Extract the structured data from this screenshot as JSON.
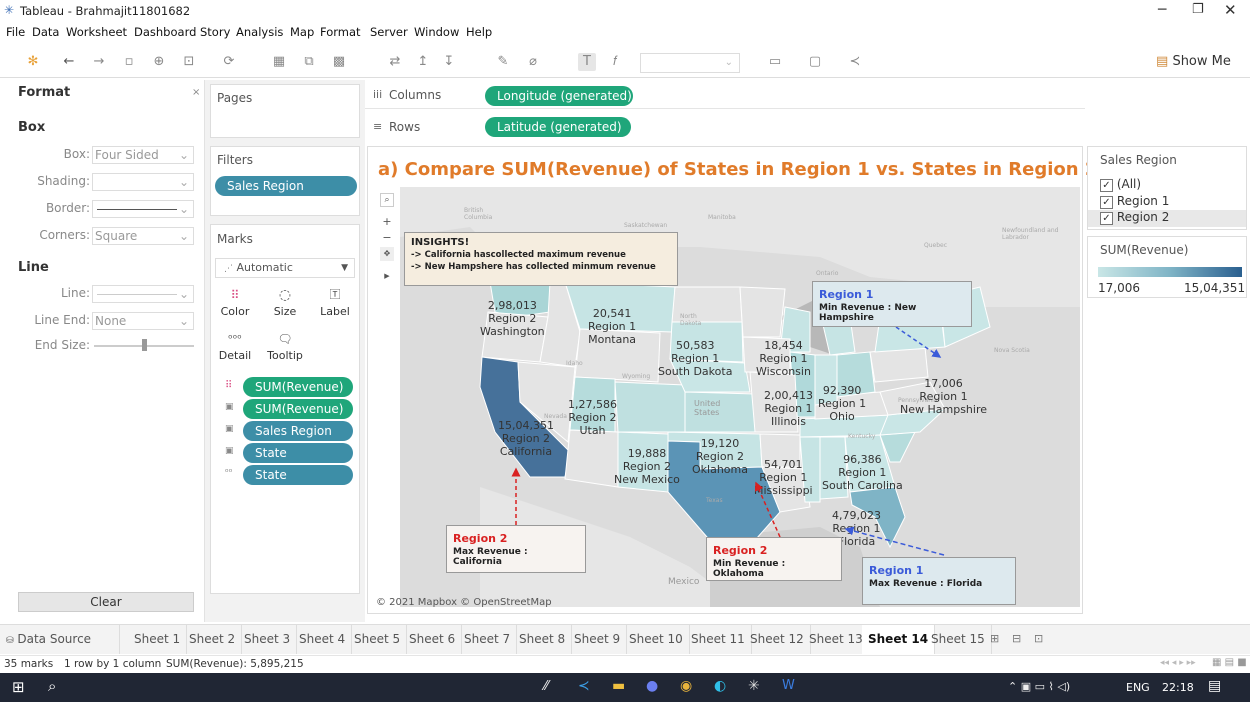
{
  "window": {
    "title": "Tableau - Brahmajit11801682"
  },
  "menu": [
    "File",
    "Data",
    "Worksheet",
    "Dashboard",
    "Story",
    "Analysis",
    "Map",
    "Format",
    "Server",
    "Window",
    "Help"
  ],
  "toolbar": {
    "show_me": "Show Me"
  },
  "format_panel": {
    "title": "Format",
    "box_section": "Box",
    "box_label": "Box:",
    "box_value": "Four Sided",
    "shading_label": "Shading:",
    "border_label": "Border:",
    "corners_label": "Corners:",
    "corners_value": "Square",
    "line_section": "Line",
    "line_label": "Line:",
    "line_end_label": "Line End:",
    "line_end_value": "None",
    "end_size_label": "End Size:",
    "clear": "Clear"
  },
  "cards": {
    "pages": "Pages",
    "filters": "Filters",
    "filter_pill": "Sales Region",
    "marks": "Marks",
    "mark_type": "Automatic",
    "mark_buttons": [
      "Color",
      "Size",
      "Label",
      "Detail",
      "Tooltip"
    ],
    "mark_pills": [
      "SUM(Revenue)",
      "SUM(Revenue)",
      "Sales Region",
      "State",
      "State"
    ]
  },
  "shelves": {
    "columns_label": "Columns",
    "columns_pill": "Longitude (generated)",
    "rows_label": "Rows",
    "rows_pill": "Latitude (generated)"
  },
  "view": {
    "title": "a) Compare SUM(Revenue) of States in Region 1 vs. States in Region 2 (Map)",
    "insights_title": "INSIGHTS!",
    "insight_1": "-> California hascollected maximum revenue",
    "insight_2": "-> New Hampshere has collected minmum revenue",
    "attribution": "© 2021 Mapbox © OpenStreetMap",
    "basemap_labels": [
      "British Columbia",
      "Saskatchewan",
      "Manitoba",
      "Ontario",
      "Quebec",
      "Newfoundland and Labrador",
      "Nova Scotia",
      "North Dakota",
      "Idaho",
      "Wyoming",
      "Nevada",
      "United States",
      "Texas",
      "Kentucky",
      "Pennsylvania",
      "Mexico"
    ],
    "states": [
      {
        "value": "2,98,013",
        "region": "Region 2",
        "name": "Washington"
      },
      {
        "value": "20,541",
        "region": "Region 1",
        "name": "Montana"
      },
      {
        "value": "50,583",
        "region": "Region 1",
        "name": "South Dakota"
      },
      {
        "value": "18,454",
        "region": "Region 1",
        "name": "Wisconsin"
      },
      {
        "value": "17,006",
        "region": "Region 1",
        "name": "New Hampshire"
      },
      {
        "value": "1,27,586",
        "region": "Region 2",
        "name": "Utah"
      },
      {
        "value": "2,00,413",
        "region": "Region 1",
        "name": "Illinois"
      },
      {
        "value": "92,390",
        "region": "Region 1",
        "name": "Ohio"
      },
      {
        "value": "15,04,351",
        "region": "Region 2",
        "name": "California"
      },
      {
        "value": "19,888",
        "region": "Region 2",
        "name": "New Mexico"
      },
      {
        "value": "19,120",
        "region": "Region 2",
        "name": "Oklahoma"
      },
      {
        "value": "54,701",
        "region": "Region 1",
        "name": "Mississippi"
      },
      {
        "value": "96,386",
        "region": "Region 1",
        "name": "South Carolina"
      },
      {
        "value": "4,79,023",
        "region": "Region 1",
        "name": "Florida"
      }
    ],
    "callouts": [
      {
        "region": "Region 1",
        "text": "Min Revenue : New Hampshire",
        "color": "#3b5bd9"
      },
      {
        "region": "Region 2",
        "text": "Max Revenue : California",
        "color": "#d92121"
      },
      {
        "region": "Region 2",
        "text": "Min Revenue : Oklahoma",
        "color": "#d92121"
      },
      {
        "region": "Region 1",
        "text": "Max Revenue : Florida",
        "color": "#3b5bd9"
      }
    ]
  },
  "legend": {
    "filter_title": "Sales Region",
    "filter_items": [
      "(All)",
      "Region 1",
      "Region 2"
    ],
    "color_title": "SUM(Revenue)",
    "min": "17,006",
    "max": "15,04,351",
    "color_low": "#c9e6e6",
    "color_high": "#2a5f8f"
  },
  "tabs": [
    "Data Source",
    "Sheet 1",
    "Sheet 2",
    "Sheet 3",
    "Sheet 4",
    "Sheet 5",
    "Sheet 6",
    "Sheet 7",
    "Sheet 8",
    "Sheet 9",
    "Sheet 10",
    "Sheet 11",
    "Sheet 12",
    "Sheet 13",
    "Sheet 14",
    "Sheet 15"
  ],
  "active_tab": "Sheet 14",
  "status": {
    "marks": "35 marks",
    "layout": "1 row by 1 column",
    "sum": "SUM(Revenue): 5,895,215"
  },
  "taskbar": {
    "lang": "ENG",
    "time": "22:18"
  }
}
